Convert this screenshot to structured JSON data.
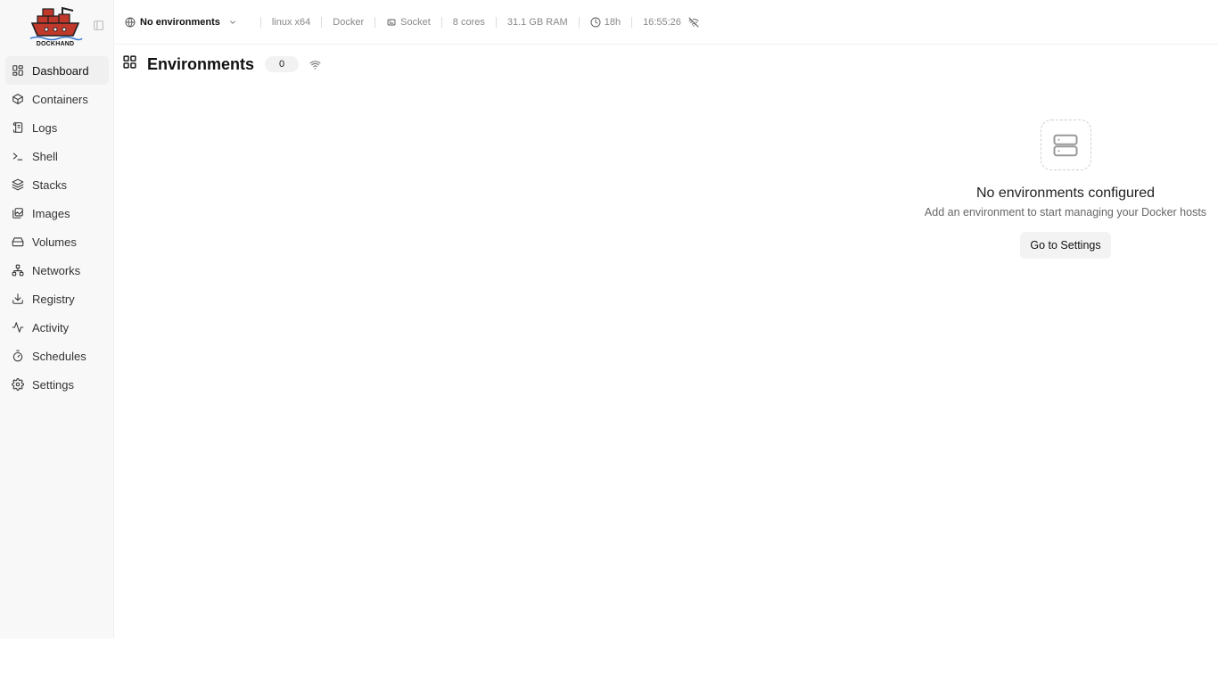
{
  "app": {
    "logo_text": "DOCKHAND"
  },
  "sidebar": {
    "items": [
      {
        "label": "Dashboard",
        "icon": "dashboard-icon",
        "active": true
      },
      {
        "label": "Containers",
        "icon": "box-icon"
      },
      {
        "label": "Logs",
        "icon": "scroll-icon"
      },
      {
        "label": "Shell",
        "icon": "terminal-icon"
      },
      {
        "label": "Stacks",
        "icon": "layers-icon"
      },
      {
        "label": "Images",
        "icon": "images-icon"
      },
      {
        "label": "Volumes",
        "icon": "hard-drive-icon"
      },
      {
        "label": "Networks",
        "icon": "network-icon"
      },
      {
        "label": "Registry",
        "icon": "download-icon"
      },
      {
        "label": "Activity",
        "icon": "activity-icon"
      },
      {
        "label": "Schedules",
        "icon": "timer-icon"
      },
      {
        "label": "Settings",
        "icon": "gear-icon"
      }
    ]
  },
  "topbar": {
    "environment": "No environments",
    "os": "linux x64",
    "engine": "Docker",
    "connection": "Socket",
    "cores": "8 cores",
    "ram": "31.1 GB RAM",
    "uptime": "18h",
    "time": "16:55:26"
  },
  "page": {
    "title": "Environments",
    "count": "0"
  },
  "empty_state": {
    "title": "No environments configured",
    "subtitle": "Add an environment to start managing your Docker hosts",
    "button": "Go to Settings"
  },
  "colors": {
    "sidebar_bg": "#f8f8f8",
    "active_bg": "#f0f0f0",
    "logo_red": "#c0392b"
  }
}
